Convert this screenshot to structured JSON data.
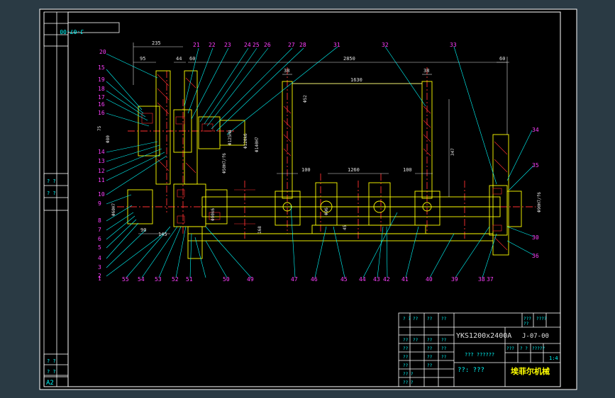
{
  "drawing": {
    "sheet_size": "A2",
    "code_topleft": "J-07-00",
    "code_titleblock": "J-07-00",
    "product": "YKS1200x2400A",
    "title_cn": "??? ??????",
    "subtitle_cn": "??:   ???",
    "company": "埃菲尔机械",
    "scale": "1:4",
    "left_labels": [
      "? ?",
      "? ?",
      "? ?",
      "? ?",
      "? ?",
      "? ?"
    ],
    "titleblock_small": [
      "? ?",
      "??",
      "??",
      "??",
      "??",
      "??",
      "??",
      "??",
      "??",
      "??",
      "??",
      "??",
      "??",
      "??",
      "??",
      "?? ?",
      "?? ?",
      "??",
      "???",
      "????",
      "??",
      "???",
      "? ?",
      "?????"
    ]
  },
  "dimensions": {
    "d235": "235",
    "d95": "95",
    "d44": "44",
    "d60a": "60",
    "d2850": "2850",
    "d60b": "60",
    "d38a": "38",
    "d38b": "38",
    "d1630": "1630",
    "d100a": "100",
    "d1260": "1260",
    "d100b": "100",
    "d347": "347",
    "d75": "75",
    "d90": "90",
    "d145": "145",
    "d168": "168",
    "d45": "45",
    "phi52": "Φ52",
    "phi80": "Φ80",
    "phi125": "Φ125H8",
    "phi120": "Φ120k6",
    "phi140": "Φ140H7",
    "phi50": "Φ50H7/f6",
    "phi90": "Φ90k6",
    "phi60": "Φ60H7",
    "phi90b": "Φ90H7/f6",
    "phi96": "Φ96"
  },
  "balloons_top": [
    "20",
    "21",
    "22",
    "23",
    "24",
    "25",
    "26",
    "27",
    "28",
    "31",
    "32",
    "33"
  ],
  "balloons_left": [
    "15",
    "19",
    "18",
    "17",
    "16",
    "16",
    "14",
    "13",
    "12",
    "11",
    "10",
    "9",
    "8",
    "7",
    "6",
    "5",
    "4",
    "3",
    "2",
    "1"
  ],
  "balloons_bottom": [
    "55",
    "54",
    "53",
    "52",
    "51",
    "50",
    "49",
    "47",
    "46",
    "45",
    "44",
    "43",
    "42",
    "41",
    "40",
    "39",
    "38",
    "37"
  ],
  "balloons_right": [
    "34",
    "35",
    "30",
    "36"
  ],
  "colors": {
    "frame": "#ffffff",
    "outline": "#ffff00",
    "dimension": "#e0e0e0",
    "leader": "#00ffff",
    "centerline": "#ff3030",
    "hidden": "#ff3030",
    "cyan_text": "#00ffff",
    "magenta_text": "#ff40ff",
    "background": "#000000",
    "border_bg": "#2a3a44"
  }
}
